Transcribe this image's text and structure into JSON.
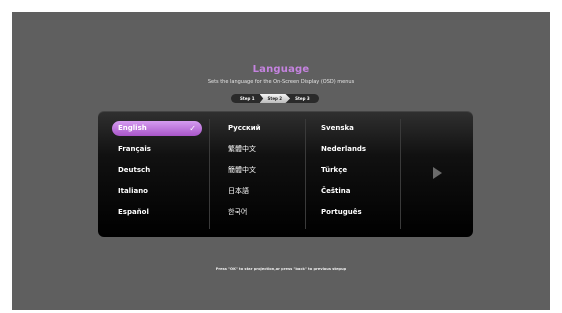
{
  "header": {
    "title": "Language",
    "subtitle": "Sets the language for the On-Screen Display (OSD) menus"
  },
  "steps": [
    "Step 1",
    "Step 2",
    "Step 3"
  ],
  "active_step": "Step 2",
  "languages": {
    "col1": [
      "English",
      "Français",
      "Deutsch",
      "Italiano",
      "Español"
    ],
    "col2": [
      "Русский",
      "繁體中文",
      "簡體中文",
      "日本語",
      "한국어"
    ],
    "col3": [
      "Svenska",
      "Nederlands",
      "Türkçe",
      "Čeština",
      "Português"
    ]
  },
  "selected_language": "English",
  "icons": {
    "selected": "checkmark-icon",
    "next_page": "arrow-right-icon"
  },
  "colors": {
    "accent": "#c583e0",
    "selection": "#b86ad8"
  },
  "footer": {
    "hint": "Press \"OK\" to star projection,or press \"back\" to previous stepup"
  }
}
